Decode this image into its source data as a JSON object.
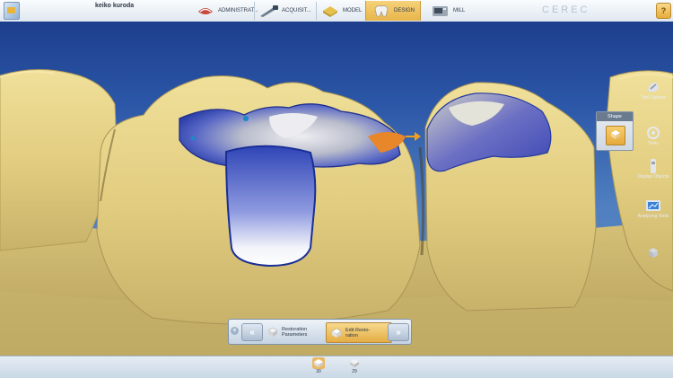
{
  "header": {
    "patient_name": "keiko kuroda",
    "phases": [
      "ADMINISTRAT...",
      "ACQUISIT...",
      "MODEL",
      "DESIGN",
      "MILL"
    ],
    "active_phase": "DESIGN",
    "brand": "CEREC"
  },
  "side_panel": {
    "shape_title": "Shape",
    "tools": [
      {
        "label": "Tool Options",
        "icon": "tool-options-icon"
      },
      {
        "label": "Tools",
        "icon": "tools-icon"
      },
      {
        "label": "Display Objects",
        "icon": "display-objects-icon"
      },
      {
        "label": "Analyzing Tools",
        "icon": "analyzing-tools-icon"
      }
    ]
  },
  "step_bar": {
    "zoom_label": "⊕",
    "prev_label": "«",
    "next_label": "»",
    "restoration_parameters": "Restoration Parameters",
    "edit_restoration": "Edit Resto- ration"
  },
  "teeth": [
    {
      "number": "30",
      "active": true
    },
    {
      "number": "29",
      "active": false
    }
  ],
  "colors": {
    "accent": "#e8b04a",
    "background": "#2c57a8",
    "tooth": "#e6d48a"
  }
}
